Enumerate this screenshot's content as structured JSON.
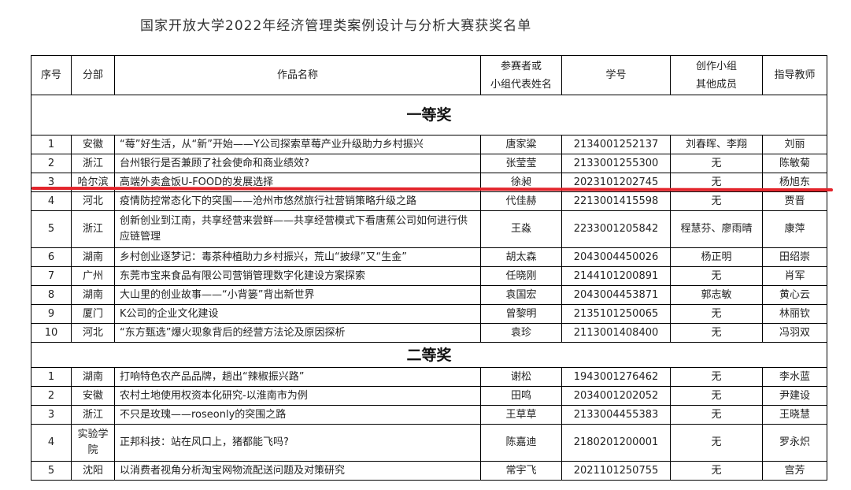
{
  "page": {
    "title": "国家开放大学2022年经济管理类案例设计与分析大赛获奖名单",
    "highlight_color": "#e3242b"
  },
  "table": {
    "headers": {
      "seq": "序号",
      "branch": "分部",
      "work": "作品名称",
      "rep_line1": "参赛者或",
      "rep_line2": "小组代表姓名",
      "student_id": "学号",
      "members_line1": "创作小组",
      "members_line2": "其他成员",
      "teacher": "指导教师"
    },
    "sections": [
      {
        "title": "一等奖",
        "rows": [
          {
            "seq": "1",
            "branch": "安徽",
            "work": "“莓”好生活，从“新”开始——Y公司探索草莓产业升级助力乡村振兴",
            "rep": "唐家粱",
            "student_id": "2134001252137",
            "members": "刘春晖、李翔",
            "teacher": "刘丽"
          },
          {
            "seq": "2",
            "branch": "浙江",
            "work": "台州银行是否兼顾了社会使命和商业绩效?",
            "rep": "张莹莹",
            "student_id": "2133001255300",
            "members": "无",
            "teacher": "陈敏菊"
          },
          {
            "seq": "3",
            "branch": "哈尔滨",
            "work": "高端外卖盒饭U-FOOD的发展选择",
            "rep": "徐昶",
            "student_id": "2023101202745",
            "members": "无",
            "teacher": "杨旭东"
          },
          {
            "seq": "4",
            "branch": "河北",
            "work": "疫情防控常态化下的突围——沧州市悠然旅行社营销策略升级之路",
            "rep": "代佳赫",
            "student_id": "2213001415598",
            "members": "无",
            "teacher": "贾晋"
          },
          {
            "seq": "5",
            "branch": "浙江",
            "work": "创新创业到江南，共享经营来尝鲜——共享经营模式下看唐蕉公司如何进行供应链管理",
            "rep": "王淼",
            "student_id": "2233001205842",
            "members": "程慧芬、廖雨晴",
            "teacher": "康萍"
          },
          {
            "seq": "6",
            "branch": "湖南",
            "work": "乡村创业逐梦记：毒茶种植助力乡村振兴，荒山“披绿”又“生金”",
            "rep": "胡太森",
            "student_id": "2043004450026",
            "members": "杨正明",
            "teacher": "田绍崇"
          },
          {
            "seq": "7",
            "branch": "广州",
            "work": "东莞市宝来食品有限公司营销管理数字化建设方案探索",
            "rep": "任晓刚",
            "student_id": "2144101200891",
            "members": "无",
            "teacher": "肖军"
          },
          {
            "seq": "8",
            "branch": "湖南",
            "work": "大山里的创业故事——“小背篓”背出新世界",
            "rep": "袁国宏",
            "student_id": "2043004453871",
            "members": "郭志敏",
            "teacher": "黄心云"
          },
          {
            "seq": "9",
            "branch": "厦门",
            "work": "K公司的企业文化建设",
            "rep": "曾黎明",
            "student_id": "2135101250065",
            "members": "无",
            "teacher": "林丽钦"
          },
          {
            "seq": "10",
            "branch": "河北",
            "work": "“东方甄选”爆火现象背后的经营方法论及原因探析",
            "rep": "袁珍",
            "student_id": "2113001408400",
            "members": "无",
            "teacher": "冯羽双"
          }
        ]
      },
      {
        "title": "二等奖",
        "rows": [
          {
            "seq": "1",
            "branch": "湖南",
            "work": "打响特色农产品品牌，趟出“辣椒振兴路”",
            "rep": "谢松",
            "student_id": "1943001276462",
            "members": "无",
            "teacher": "李水蓝"
          },
          {
            "seq": "2",
            "branch": "安徽",
            "work": "农村土地使用权资本化研究-以淮南市为例",
            "rep": "田鸣",
            "student_id": "2034001202052",
            "members": "无",
            "teacher": "尹建设"
          },
          {
            "seq": "3",
            "branch": "浙江",
            "work": "不只是玫瑰——roseonly的突围之路",
            "rep": "王草草",
            "student_id": "2133004455383",
            "members": "无",
            "teacher": "王晓慧"
          },
          {
            "seq": "4",
            "branch": "实验学院",
            "work": "正邦科技：站在风口上，猪都能飞吗?",
            "rep": "陈嘉迪",
            "student_id": "2180201200001",
            "members": "无",
            "teacher": "罗永炽"
          },
          {
            "seq": "5",
            "branch": "沈阳",
            "work": "以消费者视角分析淘宝网物流配送问题及对策研究",
            "rep": "常宇飞",
            "student_id": "2021101250755",
            "members": "无",
            "teacher": "宫芳"
          }
        ]
      }
    ]
  }
}
